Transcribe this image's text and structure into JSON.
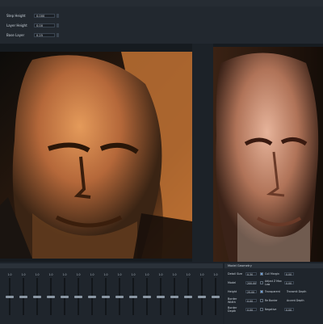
{
  "top_panel": {
    "params": [
      {
        "label": "Step Height",
        "value": "0.000"
      },
      {
        "label": "Layer Height",
        "value": "0.00"
      },
      {
        "label": "Base Layer",
        "value": "0.25"
      }
    ]
  },
  "panels": {
    "geometry_title": "Model Geometry"
  },
  "mixer": {
    "channels": [
      {
        "value": "1.0",
        "level": 0.5
      },
      {
        "value": "1.0",
        "level": 0.5
      },
      {
        "value": "1.0",
        "level": 0.5
      },
      {
        "value": "1.0",
        "level": 0.5
      },
      {
        "value": "1.0",
        "level": 0.5
      },
      {
        "value": "1.0",
        "level": 0.5
      },
      {
        "value": "1.0",
        "level": 0.5
      },
      {
        "value": "1.0",
        "level": 0.5
      },
      {
        "value": "1.0",
        "level": 0.5
      },
      {
        "value": "1.0",
        "level": 0.5
      },
      {
        "value": "1.0",
        "level": 0.5
      },
      {
        "value": "1.0",
        "level": 0.5
      },
      {
        "value": "1.0",
        "level": 0.5
      },
      {
        "value": "1.0",
        "level": 0.5
      },
      {
        "value": "1.0",
        "level": 0.5
      },
      {
        "value": "1.0",
        "level": 0.5
      }
    ]
  },
  "geometry": {
    "rows": [
      {
        "label": "Detail Size",
        "value": "0.30",
        "checked": true,
        "label2": "Cull Margin",
        "value2": "0.00"
      },
      {
        "label": "Model",
        "value": "200.00",
        "checked": false,
        "label2": "Adjust Z Max Low",
        "value2": "0.00"
      },
      {
        "label": "Height",
        "value": "25.00",
        "checked": true,
        "label2": "Transparent",
        "label3": "Transmit Depth"
      },
      {
        "label": "Border Width",
        "value": "0.00",
        "checked": false,
        "label2": "Re Border",
        "label3": "Accent Depth"
      },
      {
        "label": "Border Depth",
        "value": "0.00",
        "checked": false,
        "label2": "Negative",
        "value2": "0.00"
      }
    ]
  },
  "colors": {
    "accent": "#6fa0d8",
    "processed_tint": "#d07a3a",
    "source_tint": "#8a5a3c"
  }
}
